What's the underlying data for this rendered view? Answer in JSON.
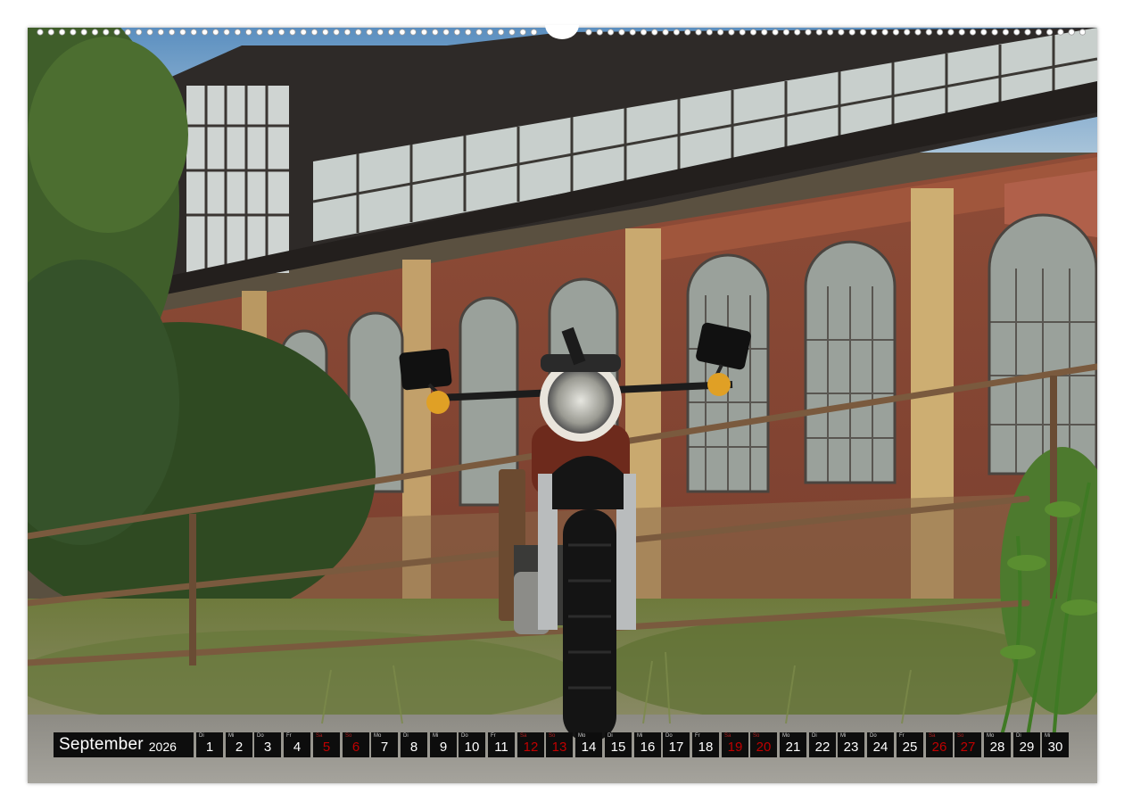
{
  "calendar": {
    "month": "September",
    "year": "2026",
    "days": [
      {
        "wd": "Di",
        "num": "1",
        "weekend": false
      },
      {
        "wd": "Mi",
        "num": "2",
        "weekend": false
      },
      {
        "wd": "Do",
        "num": "3",
        "weekend": false
      },
      {
        "wd": "Fr",
        "num": "4",
        "weekend": false
      },
      {
        "wd": "Sa",
        "num": "5",
        "weekend": true
      },
      {
        "wd": "So",
        "num": "6",
        "weekend": true
      },
      {
        "wd": "Mo",
        "num": "7",
        "weekend": false
      },
      {
        "wd": "Di",
        "num": "8",
        "weekend": false
      },
      {
        "wd": "Mi",
        "num": "9",
        "weekend": false
      },
      {
        "wd": "Do",
        "num": "10",
        "weekend": false
      },
      {
        "wd": "Fr",
        "num": "11",
        "weekend": false
      },
      {
        "wd": "Sa",
        "num": "12",
        "weekend": true
      },
      {
        "wd": "So",
        "num": "13",
        "weekend": true
      },
      {
        "wd": "Mo",
        "num": "14",
        "weekend": false
      },
      {
        "wd": "Di",
        "num": "15",
        "weekend": false
      },
      {
        "wd": "Mi",
        "num": "16",
        "weekend": false
      },
      {
        "wd": "Do",
        "num": "17",
        "weekend": false
      },
      {
        "wd": "Fr",
        "num": "18",
        "weekend": false
      },
      {
        "wd": "Sa",
        "num": "19",
        "weekend": true
      },
      {
        "wd": "So",
        "num": "20",
        "weekend": true
      },
      {
        "wd": "Mo",
        "num": "21",
        "weekend": false
      },
      {
        "wd": "Di",
        "num": "22",
        "weekend": false
      },
      {
        "wd": "Mi",
        "num": "23",
        "weekend": false
      },
      {
        "wd": "Do",
        "num": "24",
        "weekend": false
      },
      {
        "wd": "Fr",
        "num": "25",
        "weekend": false
      },
      {
        "wd": "Sa",
        "num": "26",
        "weekend": true
      },
      {
        "wd": "So",
        "num": "27",
        "weekend": true
      },
      {
        "wd": "Mo",
        "num": "28",
        "weekend": false
      },
      {
        "wd": "Di",
        "num": "29",
        "weekend": false
      },
      {
        "wd": "Mi",
        "num": "30",
        "weekend": false
      }
    ]
  },
  "colors": {
    "strip_background": "#0d0d0d",
    "weekday_text": "#ffffff",
    "weekend_text": "#c00000"
  }
}
